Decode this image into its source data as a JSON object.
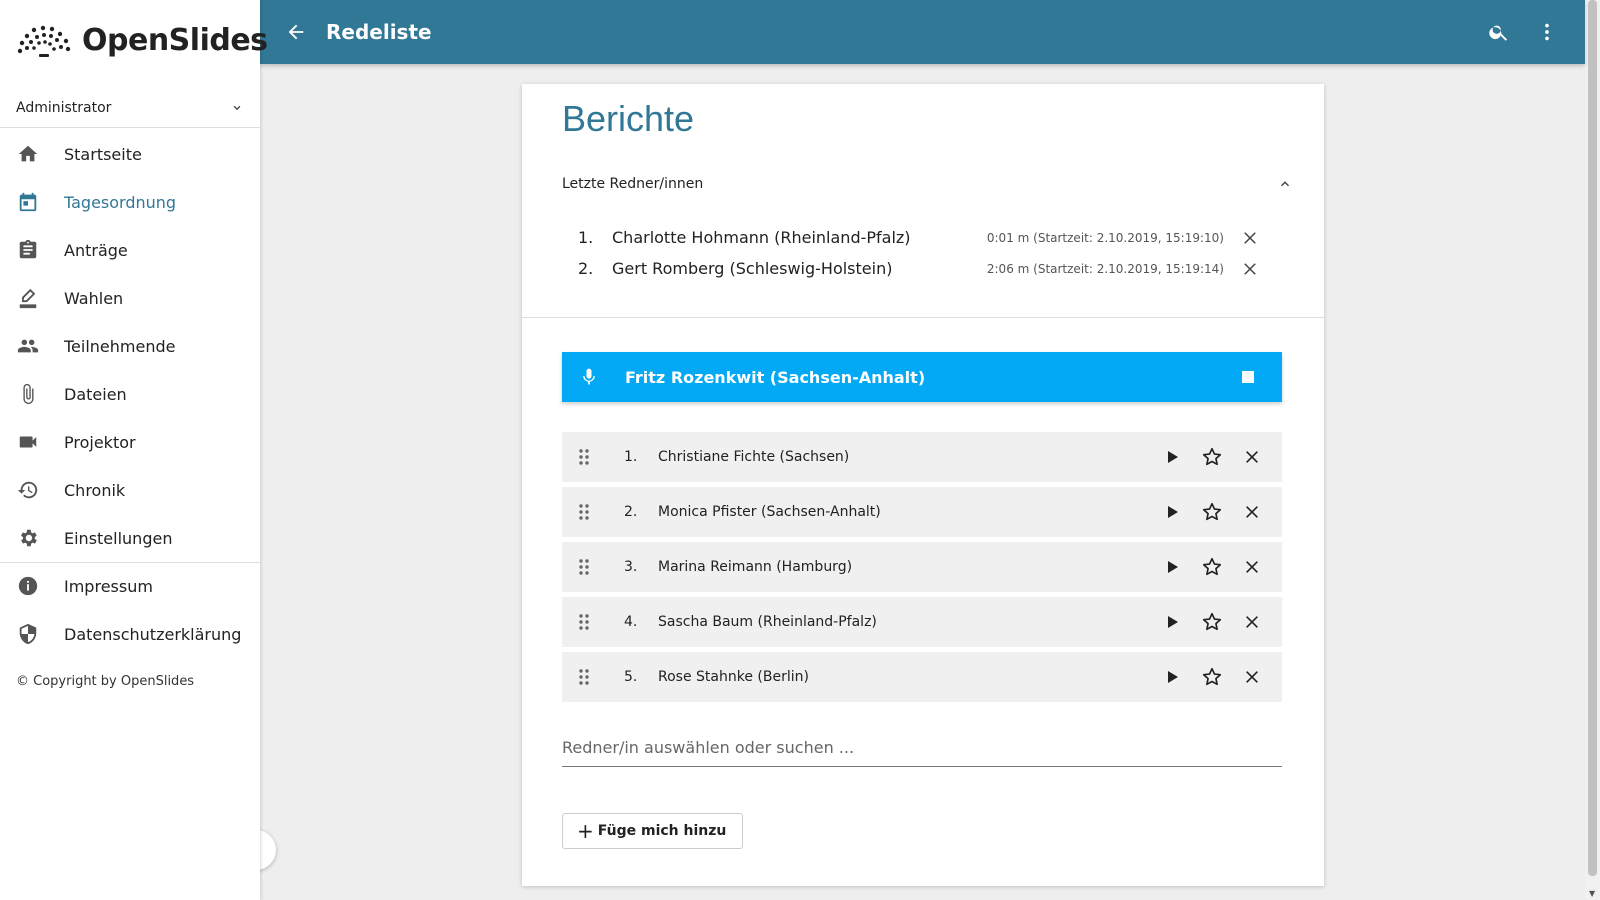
{
  "brand": {
    "name": "OpenSlides"
  },
  "user": {
    "name": "Administrator"
  },
  "sidebar": {
    "items": [
      {
        "label": "Startseite",
        "icon": "home-icon"
      },
      {
        "label": "Tagesordnung",
        "icon": "calendar-icon",
        "active": true
      },
      {
        "label": "Anträge",
        "icon": "clipboard-icon"
      },
      {
        "label": "Wahlen",
        "icon": "ballot-icon"
      },
      {
        "label": "Teilnehmende",
        "icon": "people-icon"
      },
      {
        "label": "Dateien",
        "icon": "paperclip-icon"
      },
      {
        "label": "Projektor",
        "icon": "videocam-icon"
      },
      {
        "label": "Chronik",
        "icon": "history-icon"
      },
      {
        "label": "Einstellungen",
        "icon": "gear-icon"
      }
    ],
    "legal": [
      {
        "label": "Impressum",
        "icon": "info-icon"
      },
      {
        "label": "Datenschutzerklärung",
        "icon": "shield-icon"
      }
    ],
    "copyright": "© Copyright by OpenSlides"
  },
  "header": {
    "title": "Redeliste"
  },
  "main": {
    "title": "Berichte",
    "last_speakers": {
      "label": "Letzte Redner/innen",
      "items": [
        {
          "num": "1.",
          "name": "Charlotte Hohmann (Rheinland-Pfalz)",
          "time": "0:01 m (Startzeit: 2.10.2019, 15:19:10)"
        },
        {
          "num": "2.",
          "name": "Gert Romberg (Schleswig-Holstein)",
          "time": "2:06 m (Startzeit: 2.10.2019, 15:19:14)"
        }
      ]
    },
    "current_speaker": {
      "name": "Fritz Rozenkwit (Sachsen-Anhalt)"
    },
    "queue": [
      {
        "num": "1.",
        "name": "Christiane Fichte (Sachsen)"
      },
      {
        "num": "2.",
        "name": "Monica Pfister (Sachsen-Anhalt)"
      },
      {
        "num": "3.",
        "name": "Marina Reimann (Hamburg)"
      },
      {
        "num": "4.",
        "name": "Sascha Baum (Rheinland-Pfalz)"
      },
      {
        "num": "5.",
        "name": "Rose Stahnke (Berlin)"
      }
    ],
    "search": {
      "placeholder": "Redner/in auswählen oder suchen ...",
      "value": ""
    },
    "add_me_label": "Füge mich hinzu"
  },
  "colors": {
    "primary": "#317796",
    "accent": "#03a9f4",
    "background": "#eeeeee"
  }
}
